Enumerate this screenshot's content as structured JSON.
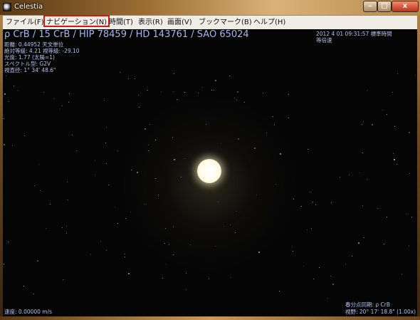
{
  "window": {
    "title": "Celestia",
    "buttons": {
      "minimize": "–",
      "maximize": "□",
      "close": "x"
    }
  },
  "menu": [
    {
      "label": "ファイル(F)"
    },
    {
      "label": "ナビゲーション(N)"
    },
    {
      "label": "時間(T)"
    },
    {
      "label": "表示(R)"
    },
    {
      "label": "画面(V)"
    },
    {
      "label": "ブックマーク(B)"
    },
    {
      "label": "ヘルプ(H)"
    }
  ],
  "hud": {
    "object_name": "ρ CrB / 15 CrB / HIP 78459 / HD 143761 / SAO 65024",
    "info_lines": [
      "距離: 0.44952 天文単位",
      "絶対等級: 4.21 視等級: -29.10",
      "光度: 1.77 (太陽=1)",
      "スペクトル型: G2V",
      "視直径: 1° 34' 48.6\""
    ],
    "datetime": "2012 4 01 09:31:57 標準時間",
    "time_rate": "等倍速",
    "speed": "速度: 0.00000 m/s",
    "tracking": "春分点同期: ρ CrB",
    "fov": "視野: 20° 17' 18.8\" (1.00x)"
  },
  "colors": {
    "hud_text": "#b6c0ec",
    "menu_highlight_border": "#d01818",
    "sky": "#050506",
    "star_core": "#ffffff"
  }
}
